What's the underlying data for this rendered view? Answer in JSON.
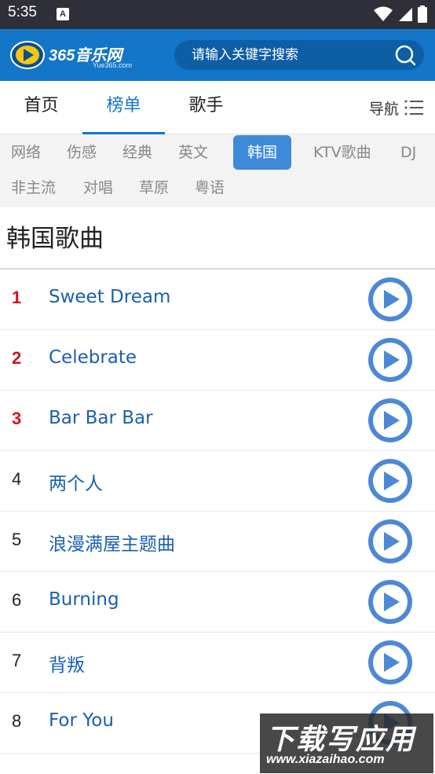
{
  "status_bar": {
    "time": "5:35",
    "notification_icon": "A"
  },
  "header": {
    "logo_text": "365音乐网",
    "logo_sub": "Yue365.com",
    "search_placeholder": "请输入关键字搜索"
  },
  "tabs": [
    {
      "label": "首页",
      "active": false
    },
    {
      "label": "榜单",
      "active": true
    },
    {
      "label": "歌手",
      "active": false
    }
  ],
  "nav_label": "导航",
  "categories": [
    {
      "label": "网络"
    },
    {
      "label": "伤感"
    },
    {
      "label": "经典"
    },
    {
      "label": "英文"
    },
    {
      "label": "韩国",
      "active": true
    },
    {
      "label": "KTV歌曲"
    },
    {
      "label": "DJ"
    },
    {
      "label": "非主流"
    },
    {
      "label": "对唱"
    },
    {
      "label": "草原"
    },
    {
      "label": "粤语"
    }
  ],
  "section_title": "韩国歌曲",
  "songs": [
    {
      "rank": "1",
      "title": "Sweet Dream"
    },
    {
      "rank": "2",
      "title": "Celebrate"
    },
    {
      "rank": "3",
      "title": "Bar Bar Bar"
    },
    {
      "rank": "4",
      "title": "两个人"
    },
    {
      "rank": "5",
      "title": "浪漫满屋主题曲"
    },
    {
      "rank": "6",
      "title": "Burning"
    },
    {
      "rank": "7",
      "title": "背叛"
    },
    {
      "rank": "8",
      "title": "For You"
    }
  ],
  "watermark": {
    "main": "下载写应用",
    "sub": "www.xiazaihao.com"
  },
  "colors": {
    "header": "#1476c8",
    "accent": "#1476c8",
    "top_rank": "#d4141c",
    "song_title": "#1a5fb0",
    "status_bar": "#2f2f3a"
  }
}
